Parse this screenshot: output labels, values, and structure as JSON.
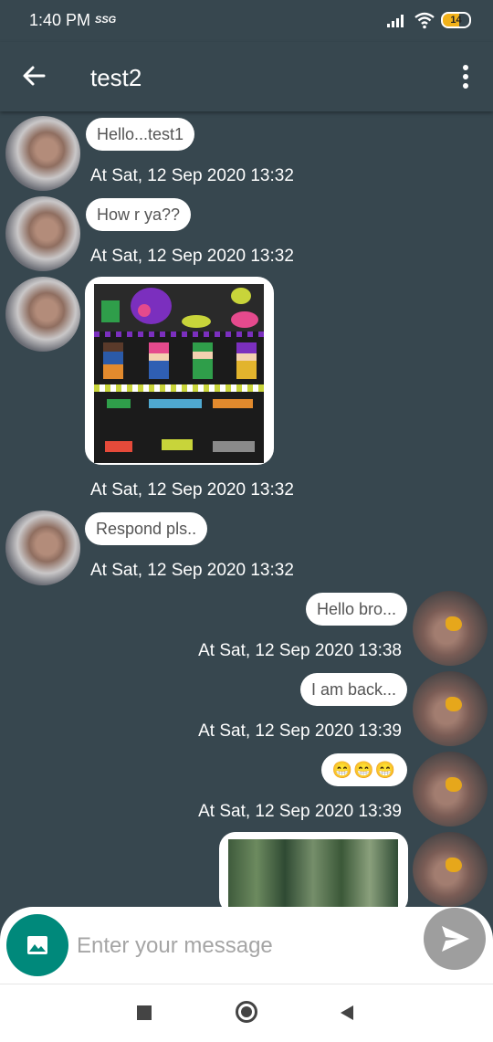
{
  "status_bar": {
    "time": "1:40 PM",
    "network": "SSG",
    "battery": "14"
  },
  "app_bar": {
    "title": "test2"
  },
  "messages": [
    {
      "sender": "other",
      "type": "text",
      "text": "Hello...test1",
      "timestamp": "At Sat, 12 Sep 2020 13:32"
    },
    {
      "sender": "other",
      "type": "text",
      "text": "How r ya??",
      "timestamp": "At Sat, 12 Sep 2020 13:32"
    },
    {
      "sender": "other",
      "type": "image",
      "image": "pixel-art-image",
      "timestamp": "At Sat, 12 Sep 2020 13:32"
    },
    {
      "sender": "other",
      "type": "text",
      "text": "Respond pls..",
      "timestamp": "At Sat, 12 Sep 2020 13:32"
    },
    {
      "sender": "self",
      "type": "text",
      "text": "Hello bro...",
      "timestamp": "At Sat, 12 Sep 2020 13:38"
    },
    {
      "sender": "self",
      "type": "text",
      "text": "I am back...",
      "timestamp": "At Sat, 12 Sep 2020 13:39"
    },
    {
      "sender": "self",
      "type": "emoji",
      "text": "😁😁😁",
      "timestamp": "At Sat, 12 Sep 2020 13:39"
    },
    {
      "sender": "self",
      "type": "image",
      "image": "forest-photo",
      "timestamp": ""
    }
  ],
  "composer": {
    "placeholder": "Enter your message"
  },
  "icons": {
    "back": "arrow-left-icon",
    "more": "more-vertical-icon",
    "attach": "image-icon",
    "send": "send-icon"
  },
  "colors": {
    "background": "#37474f",
    "bubble": "#ffffff",
    "attach_button": "#00897b",
    "send_button": "#9e9e9e"
  }
}
